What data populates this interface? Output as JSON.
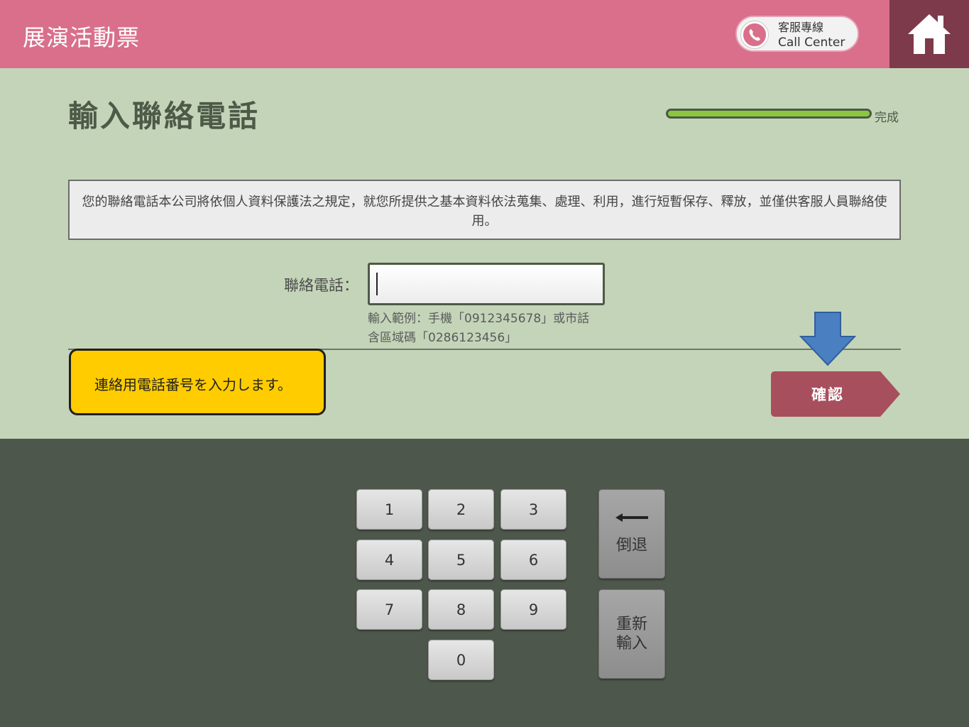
{
  "header": {
    "app_title": "展演活動票",
    "call_center_line1": "客服專線",
    "call_center_line2": "Call Center"
  },
  "page": {
    "title": "輸入聯絡電話",
    "progress_label": "完成",
    "progress_fraction": 1.0
  },
  "notice": "您的聯絡電話本公司將依個人資料保護法之規定，就您所提供之基本資料依法蒐集、處理、利用，進行短暫保存、釋放，並僅供客服人員聯絡使用。",
  "form": {
    "phone_label": "聯絡電話：",
    "phone_value": "",
    "hint_line1": "輸入範例：手機「0912345678」或市話",
    "hint_line2": "含區域碼「0286123456」"
  },
  "callout": "連絡用電話番号を入力します。",
  "confirm_label": "確認",
  "keypad": {
    "keys": [
      "1",
      "2",
      "3",
      "4",
      "5",
      "6",
      "7",
      "8",
      "9",
      "0"
    ],
    "backspace_label": "倒退",
    "reset_label": "重新輸入"
  },
  "colors": {
    "header": "#d96f8b",
    "home": "#7d3a4b",
    "body": "#c4d4b8",
    "keypad_bg": "#4e574b",
    "confirm": "#a84f5e",
    "callout": "#ffcc00",
    "arrow": "#4a7fc1",
    "progress": "#8cc63f"
  }
}
